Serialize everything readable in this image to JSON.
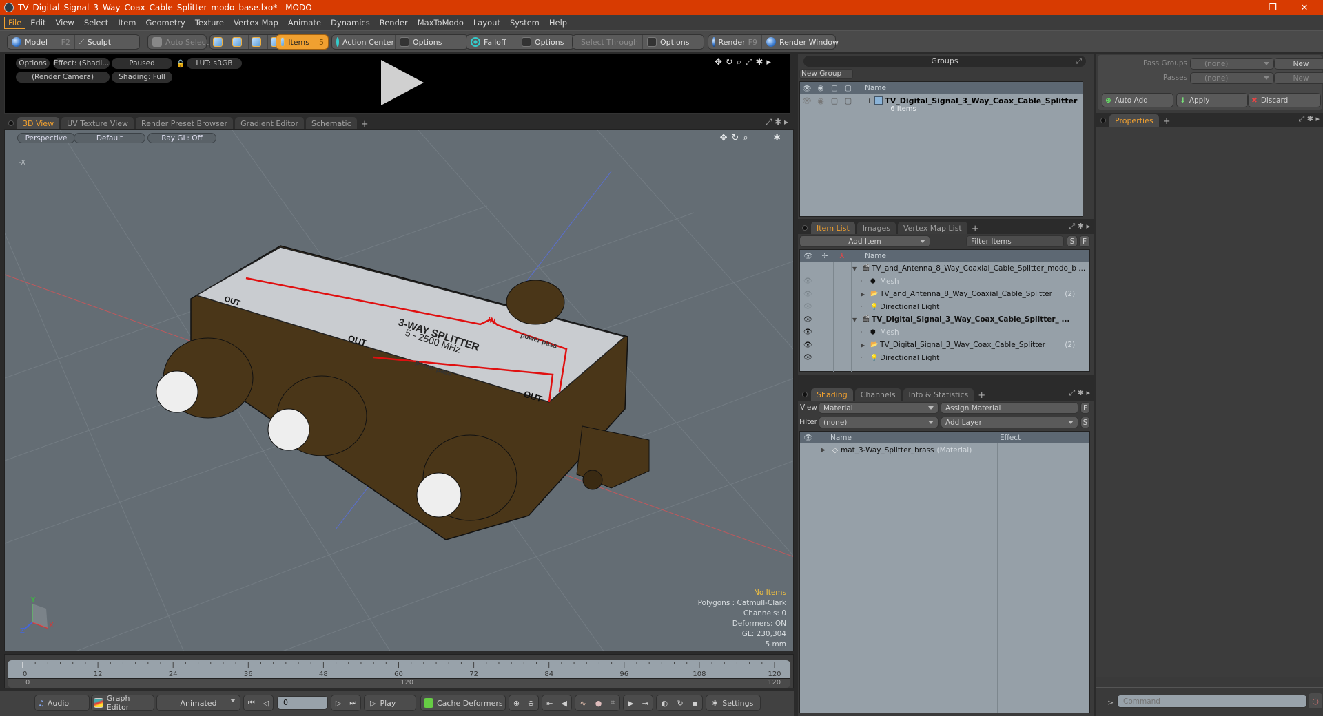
{
  "window": {
    "title": "TV_Digital_Signal_3_Way_Coax_Cable_Splitter_modo_base.lxo* - MODO",
    "controls": {
      "minimize": "—",
      "restore": "❐",
      "close": "✕"
    }
  },
  "menu": [
    "File",
    "Edit",
    "View",
    "Select",
    "Item",
    "Geometry",
    "Texture",
    "Vertex Map",
    "Animate",
    "Dynamics",
    "Render",
    "MaxToModo",
    "Layout",
    "System",
    "Help"
  ],
  "toolbar": {
    "model": "Model",
    "model_key": "F2",
    "sculpt": "Sculpt",
    "auto_select": "Auto Select",
    "items": "Items",
    "items_key": "5",
    "action_center": "Action Center",
    "options1": "Options",
    "falloff": "Falloff",
    "options2": "Options",
    "select_through": "Select Through",
    "options3": "Options",
    "render": "Render",
    "render_key": "F9",
    "render_window": "Render Window"
  },
  "preview": {
    "options": "Options",
    "effect": "Effect: (Shadi...",
    "paused": "Paused",
    "lut": "LUT: sRGB",
    "camera": "(Render Camera)",
    "shading": "Shading: Full"
  },
  "viewport_tabs": [
    "3D View",
    "UV Texture View",
    "Render Preset Browser",
    "Gradient Editor",
    "Schematic"
  ],
  "viewport": {
    "projection": "Perspective",
    "style": "Default",
    "raygl": "Ray GL: Off",
    "axis_label": "-X",
    "info": {
      "selection": "No Items",
      "polygons": "Polygons : Catmull-Clark",
      "channels": "Channels: 0",
      "deformers": "Deformers: ON",
      "gl": "GL: 230,304",
      "scale": "5 mm"
    },
    "model_labels": {
      "title": "3-WAY SPLITTER",
      "freq": "5 - 2500 MHz",
      "in": "IN",
      "out": "OUT",
      "power_pass": "power pass"
    },
    "gizmo": {
      "x": "X",
      "y": "Y",
      "z": "Z"
    }
  },
  "timeline": {
    "ticks": [
      "0",
      "12",
      "24",
      "36",
      "48",
      "60",
      "72",
      "84",
      "96",
      "108",
      "120"
    ],
    "range_start": "0",
    "range_end": "120",
    "range_end2": "120"
  },
  "bottombar": {
    "audio": "Audio",
    "graph_editor": "Graph Editor",
    "animated": "Animated",
    "frame": "0",
    "play": "Play",
    "cache_deformers": "Cache Deformers",
    "settings": "Settings"
  },
  "groups": {
    "title": "Groups",
    "new_group": "New Group",
    "col_name": "Name",
    "rows": [
      {
        "name": "TV_Digital_Signal_3_Way_Coax_Cable_Splitter",
        "sub": "6 Items"
      }
    ]
  },
  "itemlist": {
    "tabs": [
      "Item List",
      "Images",
      "Vertex Map List"
    ],
    "add_item": "Add Item",
    "filter_placeholder": "Filter Items",
    "s": "S",
    "f": "F",
    "col_name": "Name",
    "rows": [
      {
        "name": "TV_and_Antenna_8_Way_Coaxial_Cable_Splitter_modo_b ...",
        "count": "",
        "type": "scene",
        "bold": false,
        "indent": 0
      },
      {
        "name": "Mesh",
        "count": "",
        "type": "mesh",
        "bold": false,
        "indent": 1
      },
      {
        "name": "TV_and_Antenna_8_Way_Coaxial_Cable_Splitter",
        "count": "(2)",
        "type": "group",
        "bold": false,
        "indent": 1
      },
      {
        "name": "Directional Light",
        "count": "",
        "type": "light",
        "bold": false,
        "indent": 1
      },
      {
        "name": "TV_Digital_Signal_3_Way_Coax_Cable_Splitter_ ...",
        "count": "",
        "type": "scene",
        "bold": true,
        "indent": 0
      },
      {
        "name": "Mesh",
        "count": "",
        "type": "mesh",
        "bold": false,
        "indent": 1
      },
      {
        "name": "TV_Digital_Signal_3_Way_Coax_Cable_Splitter",
        "count": "(2)",
        "type": "group",
        "bold": false,
        "indent": 1
      },
      {
        "name": "Directional Light",
        "count": "",
        "type": "light",
        "bold": false,
        "indent": 1
      }
    ]
  },
  "shading": {
    "tabs": [
      "Shading",
      "Channels",
      "Info & Statistics"
    ],
    "view_label": "View",
    "view_value": "Material",
    "assign_material": "Assign Material",
    "f": "F",
    "filter_label": "Filter",
    "filter_value": "(none)",
    "add_layer": "Add Layer",
    "s": "S",
    "col_name": "Name",
    "col_effect": "Effect",
    "rows": [
      {
        "name": "mat_3-Way_Splitter_brass",
        "type": "(Material)"
      }
    ]
  },
  "passes": {
    "pass_groups_label": "Pass Groups",
    "pass_groups_value": "(none)",
    "new1": "New",
    "passes_label": "Passes",
    "passes_value": "(none)",
    "new2": "New",
    "auto_add": "Auto Add",
    "apply": "Apply",
    "discard": "Discard"
  },
  "properties": {
    "tab": "Properties"
  },
  "command": {
    "prompt": ">",
    "placeholder": "Command"
  },
  "colors": {
    "accent": "#f0a030",
    "title_bar": "#d83b01",
    "viewport_bg": "#646d74",
    "list_bg": "#96a0a8"
  }
}
